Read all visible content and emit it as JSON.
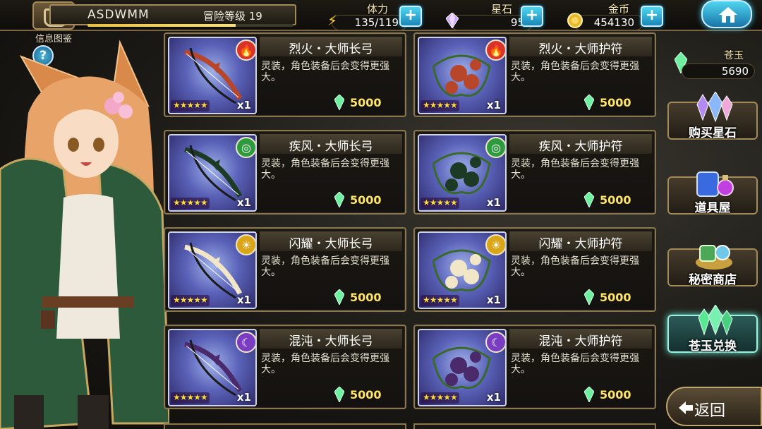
{
  "player": {
    "name": "ASDWMM",
    "level_text": "冒险等级 19",
    "exp_fraction": 0.72
  },
  "resources": {
    "stamina": {
      "label": "体力",
      "value": "135/119",
      "icon": "lightning-icon"
    },
    "star_stone": {
      "label": "星石",
      "value": "95",
      "icon": "crystal-icon"
    },
    "gold": {
      "label": "金币",
      "value": "454130",
      "icon": "coin-icon"
    }
  },
  "left_panel": {
    "info_label": "信息图鉴",
    "help_symbol": "?"
  },
  "jade": {
    "label": "苍玉",
    "value": "5690",
    "icon": "green-crystal-icon"
  },
  "side_buttons": [
    {
      "label": "购买星石",
      "icon": "crystals-icon"
    },
    {
      "label": "道具屋",
      "icon": "potion-bag-icon"
    },
    {
      "label": "秘密商店",
      "icon": "treasure-pile-icon"
    },
    {
      "label": "苍玉兑换",
      "icon": "green-crystals-icon",
      "active": true
    }
  ],
  "back_button": {
    "label": "返回"
  },
  "items": [
    {
      "title": "烈火・大师长弓",
      "desc": "灵装，角色装备后会变得更强大。",
      "qty": "x1",
      "price": "5000",
      "element": "fire",
      "kind": "bow",
      "stars": 5
    },
    {
      "title": "烈火・大师护符",
      "desc": "灵装，角色装备后会变得更强大。",
      "qty": "x1",
      "price": "5000",
      "element": "fire",
      "kind": "charm",
      "stars": 5
    },
    {
      "title": "疾风・大师长弓",
      "desc": "灵装，角色装备后会变得更强大。",
      "qty": "x1",
      "price": "5000",
      "element": "wind",
      "kind": "bow",
      "stars": 5
    },
    {
      "title": "疾风・大师护符",
      "desc": "灵装，角色装备后会变得更强大。",
      "qty": "x1",
      "price": "5000",
      "element": "wind",
      "kind": "charm",
      "stars": 5
    },
    {
      "title": "闪耀・大师长弓",
      "desc": "灵装，角色装备后会变得更强大。",
      "qty": "x1",
      "price": "5000",
      "element": "light",
      "kind": "bow",
      "stars": 5
    },
    {
      "title": "闪耀・大师护符",
      "desc": "灵装，角色装备后会变得更强大。",
      "qty": "x1",
      "price": "5000",
      "element": "light",
      "kind": "charm",
      "stars": 5
    },
    {
      "title": "混沌・大师长弓",
      "desc": "灵装，角色装备后会变得更强大。",
      "qty": "x1",
      "price": "5000",
      "element": "dark",
      "kind": "bow",
      "stars": 5
    },
    {
      "title": "混沌・大师护符",
      "desc": "灵装，角色装备后会变得更强大。",
      "qty": "x1",
      "price": "5000",
      "element": "dark",
      "kind": "charm",
      "stars": 5
    }
  ],
  "element_colors": {
    "fire": "#d8342a",
    "wind": "#2e9a3e",
    "light": "#d9a61a",
    "dark": "#7a3cc0"
  },
  "element_icons": {
    "fire": "flame-icon",
    "wind": "swirl-icon",
    "light": "sun-icon",
    "dark": "moon-icon"
  },
  "item_colors": {
    "fire": "#b8462a",
    "wind": "#1c3a24",
    "light": "#f2e6c8",
    "dark": "#4a2a6a"
  }
}
